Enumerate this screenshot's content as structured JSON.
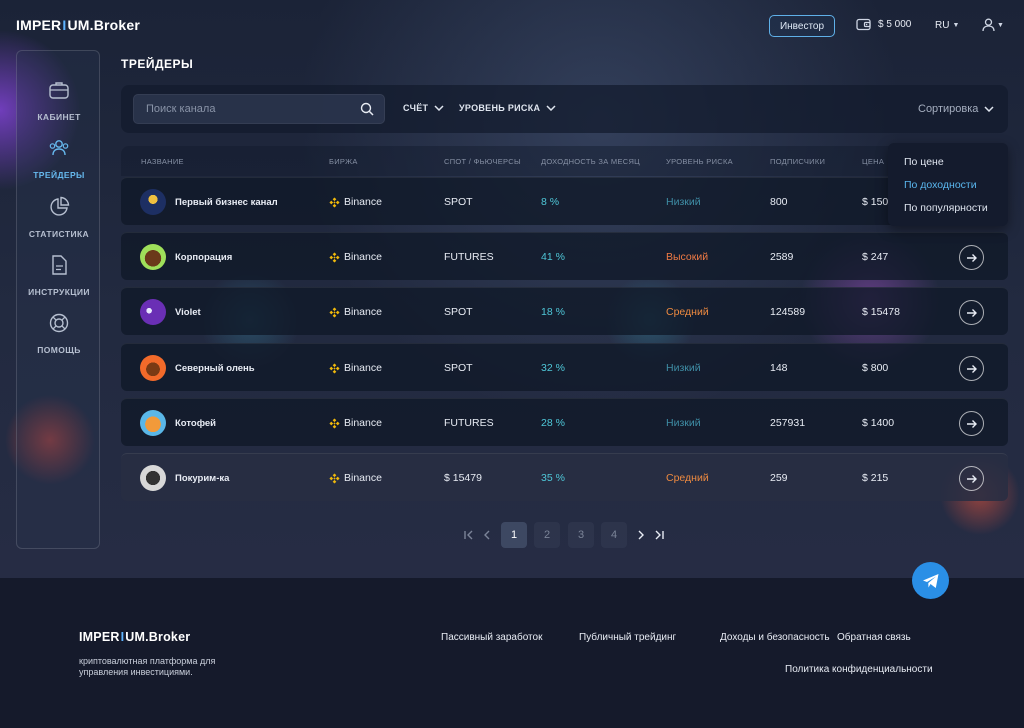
{
  "brand": {
    "name_left": "IMPER",
    "name_sep": "I",
    "name_mid": "UM",
    "name_right": ".Broker"
  },
  "header": {
    "investor_label": "Инвестор",
    "balance": "$ 5 000",
    "language": "RU"
  },
  "sidebar": {
    "items": [
      {
        "label": "КАБИНЕТ",
        "icon": "briefcase-icon"
      },
      {
        "label": "ТРЕЙДЕРЫ",
        "icon": "users-icon",
        "active": true
      },
      {
        "label": "СТАТИСТИКА",
        "icon": "pie-chart-icon"
      },
      {
        "label": "ИНСТРУКЦИИ",
        "icon": "document-icon"
      },
      {
        "label": "ПОМОЩЬ",
        "icon": "lifebuoy-icon"
      }
    ]
  },
  "page": {
    "title": "ТРЕЙДЕРЫ"
  },
  "filters": {
    "search_placeholder": "Поиск канала",
    "account_label": "СЧЁТ",
    "risk_label": "УРОВЕНЬ РИСКА",
    "sort_label": "Сортировка"
  },
  "table": {
    "columns": [
      "НАЗВАНИЕ",
      "БИРЖА",
      "СПОТ / ФЬЮЧЕРСЫ",
      "ДОХОДНОСТЬ ЗА МЕСЯЦ",
      "УРОВЕНЬ РИСКА",
      "ПОДПИСЧИКИ",
      "ЦЕНА"
    ],
    "rows": [
      {
        "name": "Первый бизнес канал",
        "exchange": "Binance",
        "type": "SPOT",
        "yield": "8 %",
        "risk": "Низкий",
        "subscribers": "800",
        "price": "$ 150"
      },
      {
        "name": "Корпорация",
        "exchange": "Binance",
        "type": "FUTURES",
        "yield": "41 %",
        "risk": "Высокий",
        "subscribers": "2589",
        "price": "$ 247"
      },
      {
        "name": "Violet",
        "exchange": "Binance",
        "type": "SPOT",
        "yield": "18 %",
        "risk": "Средний",
        "subscribers": "124589",
        "price": "$ 15478"
      },
      {
        "name": "Северный олень",
        "exchange": "Binance",
        "type": "SPOT",
        "yield": "32 %",
        "risk": "Низкий",
        "subscribers": "148",
        "price": "$ 800"
      },
      {
        "name": "Котофей",
        "exchange": "Binance",
        "type": "FUTURES",
        "yield": "28 %",
        "risk": "Низкий",
        "subscribers": "257931",
        "price": "$ 1400"
      },
      {
        "name": "Покурим-ка",
        "exchange": "Binance",
        "type": "$ 15479",
        "yield": "35 %",
        "risk": "Средний",
        "subscribers": "259",
        "price": "$ 215"
      }
    ]
  },
  "sort_menu": {
    "options": [
      "По цене",
      "По доходности",
      "По популярности"
    ],
    "active": "По доходности"
  },
  "pagination": {
    "pages": [
      "1",
      "2",
      "3",
      "4"
    ],
    "current": "1"
  },
  "footer": {
    "tagline": "криптовалютная платформа для управления инвестициями.",
    "links": [
      "Пассивный заработок",
      "Публичный трейдинг",
      "Доходы и безопасность",
      "Обратная связь",
      "Политика конфиденциальности"
    ]
  },
  "colors": {
    "accent": "#5ab7ef",
    "yield": "#4fc7d8",
    "risk_low": "#3f8ea6",
    "risk_high": "#ef7a44",
    "binance": "#f0b90b",
    "telegram": "#2a8fe6"
  }
}
